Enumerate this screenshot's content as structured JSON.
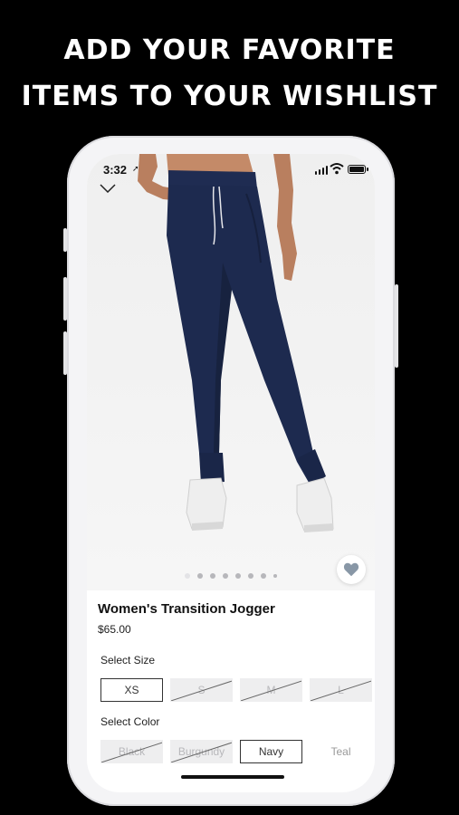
{
  "headline": {
    "line1": "ADD YOUR FAVORITE",
    "line2": "ITEMS TO YOUR WISHLIST"
  },
  "status_bar": {
    "time": "3:32",
    "location_arrow": "➚",
    "icons": [
      "signal-icon",
      "wifi-icon",
      "battery-icon"
    ]
  },
  "product": {
    "image": "navy-jogger-photo",
    "carousel": {
      "count": 8,
      "active_index": 0
    },
    "name": "Women's Transition Jogger",
    "price": "$65.00",
    "wishlist_icon": "heart-icon"
  },
  "size_selector": {
    "label": "Select Size",
    "options": [
      {
        "label": "XS",
        "available": true,
        "selected": true
      },
      {
        "label": "S",
        "available": false,
        "selected": false
      },
      {
        "label": "M",
        "available": false,
        "selected": false
      },
      {
        "label": "L",
        "available": false,
        "selected": false
      }
    ]
  },
  "color_selector": {
    "label": "Select Color",
    "options": [
      {
        "label": "Black",
        "available": false,
        "selected": false
      },
      {
        "label": "Burgundy",
        "available": false,
        "selected": false
      },
      {
        "label": "Navy",
        "available": true,
        "selected": true
      },
      {
        "label": "Teal",
        "available": true,
        "selected": false
      }
    ]
  },
  "colors": {
    "background": "#000000",
    "pants_navy": "#1d2a4f",
    "heart": "#8897a6"
  }
}
